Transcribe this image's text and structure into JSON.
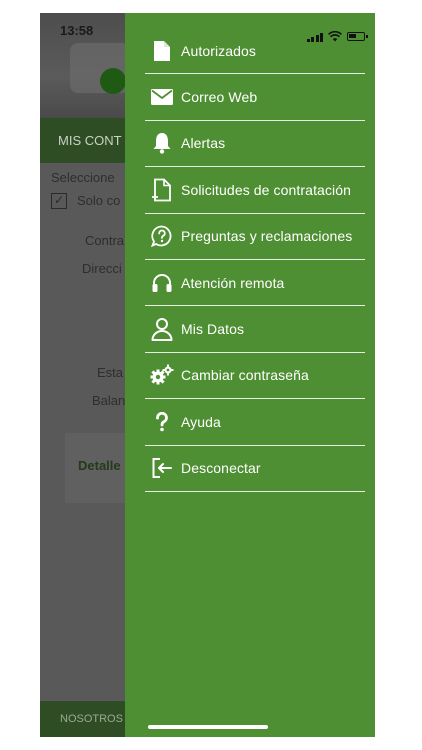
{
  "status_bar": {
    "time": "13:58"
  },
  "background": {
    "section_bar": "MIS CONT",
    "select_text": "Seleccione",
    "only_text": "Solo co",
    "field_contract": "Contra",
    "field_address": "Direcci",
    "field_status": "Esta",
    "field_balance": "Balan",
    "detail_link": "Detalle",
    "footer": "NOSOTROS"
  },
  "menu": {
    "items": [
      {
        "label": "Autorizados",
        "icon": "document-icon"
      },
      {
        "label": "Correo Web",
        "icon": "envelope-icon"
      },
      {
        "label": "Alertas",
        "icon": "bell-icon"
      },
      {
        "label": "Solicitudes de contratación",
        "icon": "document-add-icon"
      },
      {
        "label": "Preguntas y reclamaciones",
        "icon": "question-bubble-icon"
      },
      {
        "label": "Atención remota",
        "icon": "headset-icon"
      },
      {
        "label": "Mis Datos",
        "icon": "user-icon"
      },
      {
        "label": "Cambiar contraseña",
        "icon": "gears-icon"
      },
      {
        "label": "Ayuda",
        "icon": "question-mark-icon"
      },
      {
        "label": "Desconectar",
        "icon": "logout-icon"
      }
    ]
  },
  "colors": {
    "drawer": "#4f8f33",
    "header_bar": "#2e4d24"
  }
}
